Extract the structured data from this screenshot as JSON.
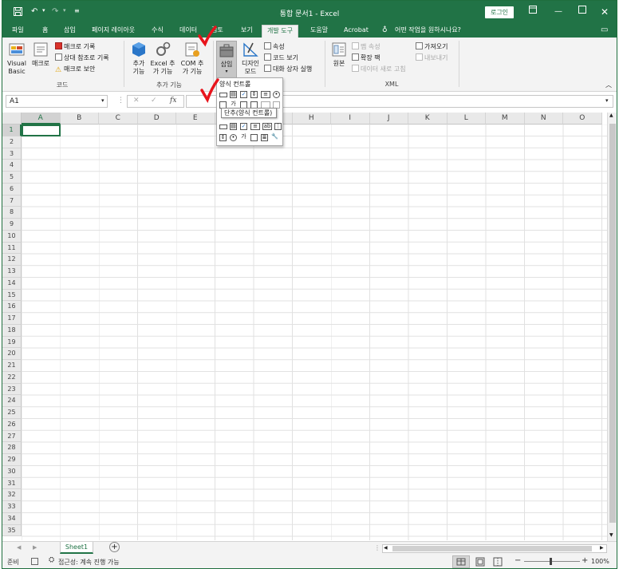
{
  "titlebar": {
    "title": "통합 문서1  -  Excel",
    "login": "로그인"
  },
  "tabs": [
    "파일",
    "홈",
    "삽입",
    "페이지 레이아웃",
    "수식",
    "데이터",
    "검토",
    "보기",
    "개발 도구",
    "도움말",
    "Acrobat",
    "어떤 작업을 원하시나요?"
  ],
  "ribbon": {
    "code": {
      "visual_basic": "Visual Basic",
      "macro": "매크로",
      "record_macro": "매크로 기록",
      "relative_ref": "상대 참조로 기록",
      "macro_security": "매크로 보안",
      "label": "코드"
    },
    "addins": {
      "addin": "추가 기능",
      "excel_addin": "Excel 추가 기능",
      "com_addin": "COM 추가 기능",
      "label": "추가 기능"
    },
    "controls": {
      "insert": "삽입",
      "design_mode": "디자인 모드",
      "properties": "속성",
      "view_code": "코드 보기",
      "run_dialog": "대화 상자 실행"
    },
    "xml": {
      "source": "원본",
      "map_props": "맵 속성",
      "expansion_packs": "확장 팩",
      "refresh_data": "데이터 새로 고침",
      "import": "가져오기",
      "export": "내보내기",
      "label": "XML"
    }
  },
  "dropdown": {
    "form_controls": "양식 컨트롤",
    "tooltip": "단추(양식 컨트롤)"
  },
  "formula_bar": {
    "namebox": "A1"
  },
  "columns": [
    "A",
    "B",
    "C",
    "D",
    "E",
    "F",
    "G",
    "H",
    "I",
    "J",
    "K",
    "L",
    "M",
    "N",
    "O"
  ],
  "rows": [
    "1",
    "2",
    "3",
    "4",
    "5",
    "6",
    "7",
    "8",
    "9",
    "10",
    "11",
    "12",
    "13",
    "14",
    "15",
    "16",
    "17",
    "18",
    "19",
    "20",
    "21",
    "22",
    "23",
    "24",
    "25",
    "26",
    "27",
    "28",
    "29",
    "30",
    "31",
    "32",
    "33",
    "34",
    "35"
  ],
  "sheet": {
    "name": "Sheet1"
  },
  "status": {
    "ready": "준비",
    "accessibility": "접근성: 계속 진행 가능",
    "zoom": "100%"
  },
  "colors": {
    "accent": "#217346",
    "annotation": "#e8141c"
  }
}
